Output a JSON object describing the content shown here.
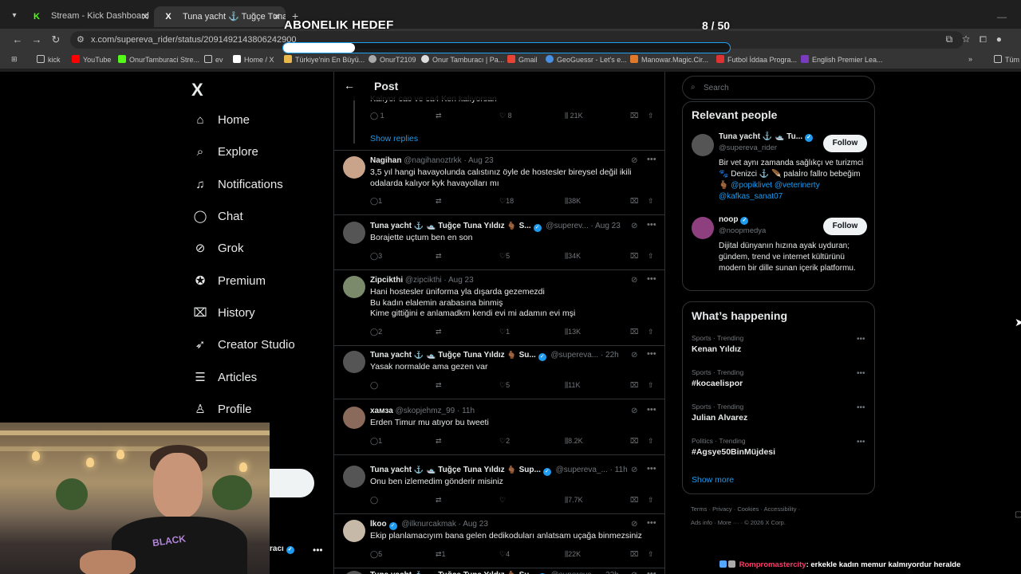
{
  "browser": {
    "tabs": [
      {
        "title": "Stream - Kick Dashboard",
        "active": false
      },
      {
        "title": "Tuna yacht ⚓️ Tuğçe Tuna Y",
        "active": true
      }
    ],
    "url": "x.com/supereva_rider/status/2091492143806242900",
    "bookmarks": [
      "kick",
      "YouTube",
      "OnurTamburaci Stre...",
      "ev",
      "Home / X",
      "Türkiye'nin En Büyü...",
      "OnurT2109",
      "Onur Tamburacı | Pa...",
      "Gmail",
      "GeoGuessr - Let's e...",
      "Manowar.Magic.Cir...",
      "Futbol İddaa Progra...",
      "English Premier Lea...",
      "Tüm"
    ]
  },
  "overlay": {
    "title": "ABONELIK HEDEF",
    "count": "8 / 50",
    "progress_fraction": 0.16
  },
  "nav": {
    "logo": "X",
    "items": [
      {
        "label": "Home",
        "icon": "home-icon",
        "glyph": "⌂"
      },
      {
        "label": "Explore",
        "icon": "search-icon",
        "glyph": "⌕"
      },
      {
        "label": "Notifications",
        "icon": "bell-icon",
        "glyph": "♫"
      },
      {
        "label": "Chat",
        "icon": "chat-icon",
        "glyph": "◯"
      },
      {
        "label": "Grok",
        "icon": "grok-icon",
        "glyph": "⊘"
      },
      {
        "label": "Premium",
        "icon": "premium-icon",
        "glyph": "✪"
      },
      {
        "label": "History",
        "icon": "bookmark-icon",
        "glyph": "⌧"
      },
      {
        "label": "Creator Studio",
        "icon": "rocket-icon",
        "glyph": "➶"
      },
      {
        "label": "Articles",
        "icon": "articles-icon",
        "glyph": "☰"
      },
      {
        "label": "Profile",
        "icon": "profile-icon",
        "glyph": "♙"
      }
    ],
    "account": "racı"
  },
  "post": {
    "header": "Post",
    "top_partial_text": "Kalıyor cao ve ca4 Ken kalıyorsan",
    "top_stats": {
      "reply": "1",
      "like": "8",
      "views": "21K"
    },
    "show_replies": "Show replies",
    "tweets": [
      {
        "name": "Nagihan",
        "handle": "@nagihanoztrkk",
        "time": "· Aug 23",
        "verified": false,
        "text": "3,5 yıl hangi havayolunda calıstınız öyle de hostesler bireysel değil ikili\nodalarda kalıyor kyk havayolları mı",
        "reply": "1",
        "repost": "",
        "like": "18",
        "views": "38K",
        "avatar": "#c9a48a"
      },
      {
        "name": "Tuna yacht ⚓️ 🛥️ Tuğçe Tuna Yıldız 🫰🏾 S...",
        "handle": "@superev...",
        "time": "· Aug 23",
        "verified": true,
        "text": "Borajette uçtum ben en son",
        "reply": "3",
        "repost": "",
        "like": "5",
        "views": "34K",
        "avatar": "#555"
      },
      {
        "name": "Zipcikthi",
        "handle": "@zipcikthi",
        "time": "· Aug 23",
        "verified": false,
        "text": "Hani hostesler üniforma yla dışarda gezemezdi\nBu kadın elalemin arabasına binmiş\nKime gittiğini e anlamadkm kendi evi mi adamın evi mşi",
        "reply": "2",
        "repost": "",
        "like": "1",
        "views": "13K",
        "avatar": "#7a8a6a"
      },
      {
        "name": "Tuna yacht ⚓️ 🛥️ Tuğçe Tuna Yıldız 🫰🏾 Su...",
        "handle": "@supereva...",
        "time": "· 22h",
        "verified": true,
        "text": "Yasak normalde ama gezen var",
        "reply": "",
        "repost": "",
        "like": "5",
        "views": "11K",
        "avatar": "#555"
      },
      {
        "name": "хамза",
        "handle": "@skopjehmz_99",
        "time": "· 11h",
        "verified": false,
        "text": "Erden Timur mu atıyor bu tweeti",
        "reply": "1",
        "repost": "",
        "like": "2",
        "views": "8.2K",
        "avatar": "#8a6a5a"
      },
      {
        "name": "Tuna yacht ⚓️ 🛥️ Tuğçe Tuna Yıldız 🫰🏾 Sup...",
        "handle": "@supereva_...",
        "time": "· 11h",
        "verified": true,
        "text": "Onu ben izlemedim gönderir misiniz",
        "reply": "",
        "repost": "",
        "like": "",
        "views": "7.7K",
        "avatar": "#555"
      },
      {
        "name": "İkoo",
        "handle": "@ilknurcakmak",
        "time": "· Aug 23",
        "verified": true,
        "text": "Ekip planlamacıyım bana gelen dedikoduları anlatsam uçağa binmezsiniz",
        "reply": "5",
        "repost": "1",
        "like": "4",
        "views": "22K",
        "avatar": "#c7b9a8"
      },
      {
        "name": "Tuna yacht ⚓️ 🛥️ Tuğçe Tuna Yıldız 🫰🏾 Su...",
        "handle": "@supereva...",
        "time": "· 22h",
        "verified": true,
        "text": "",
        "reply": "",
        "repost": "",
        "like": "",
        "views": "",
        "avatar": "#555"
      }
    ]
  },
  "sidebar": {
    "search_placeholder": "Search",
    "relevant_title": "Relevant people",
    "people": [
      {
        "name": "Tuna yacht ⚓️ 🛥️ Tu...",
        "handle": "@supereva_rider",
        "bio_pre": "Bir vet aynı zamanda sağlıkçı ve turizmci 🐾 Denizci ⚓️ 🪶 palaİro fallro bebeğim 🫰🏾 ",
        "bio_links": "@popiklivet @veterinerty @kafkas_sanat07",
        "follow": "Follow",
        "avatar": "#555"
      },
      {
        "name": "noop",
        "handle": "@noopmedya",
        "bio_pre": "Dijital dünyanın hızına ayak uyduran; gündem, trend ve internet kültürünü modern bir dille sunan içerik platformu.",
        "bio_links": "",
        "follow": "Follow",
        "avatar": "#8e3f7e"
      }
    ],
    "happening_title": "What’s happening",
    "trends": [
      {
        "category": "Sports · Trending",
        "name": "Kenan Yıldız"
      },
      {
        "category": "Sports · Trending",
        "name": "#kocaelispor"
      },
      {
        "category": "Sports · Trending",
        "name": "Julian Alvarez"
      },
      {
        "category": "Politics · Trending",
        "name": "#Agsye50BinMüjdesi"
      }
    ],
    "show_more": "Show more",
    "footer_line1": "Terms · Privacy · Cookies · Accessibility ·",
    "footer_line2": "Ads info · More ··· · © 2026 X Corp."
  },
  "stream": {
    "chat_user": "Rompromastercity",
    "chat_msg": ": erkekle kadın memur kalmıyordur heralde",
    "shirt_text": "BLACK"
  },
  "colors": {
    "accent": "#1d9bf0",
    "kick": "#53fc18",
    "bg": "#000000"
  }
}
